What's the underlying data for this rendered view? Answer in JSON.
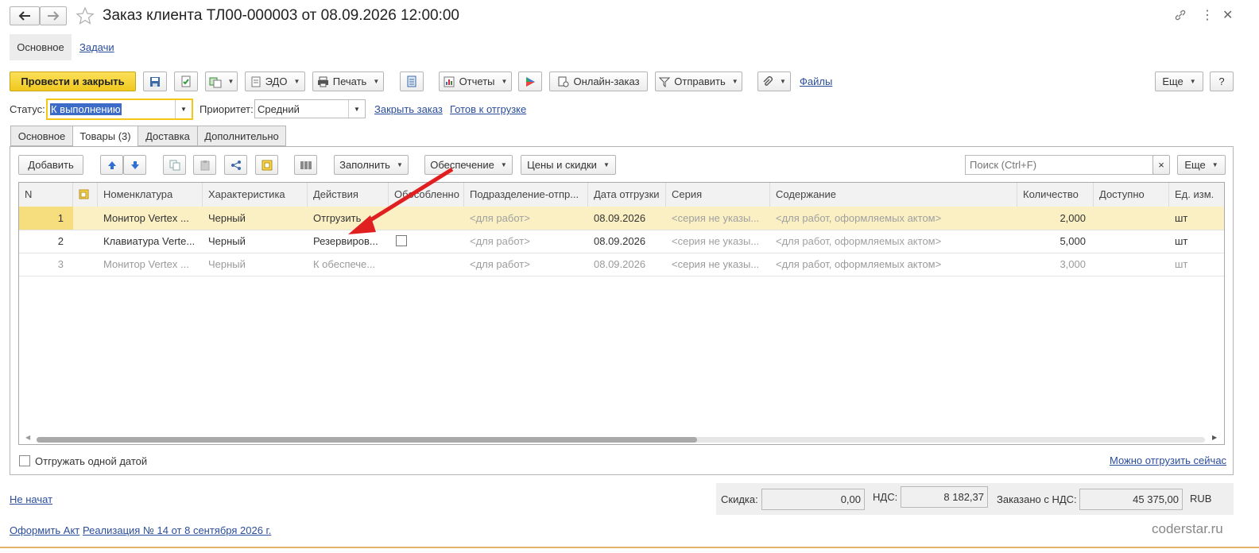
{
  "window": {
    "title": "Заказ клиента ТЛ00-000003 от 08.09.2026 12:00:00"
  },
  "nav": {
    "main": "Основное",
    "tasks": "Задачи"
  },
  "toolbar": {
    "post_close": "Провести и закрыть",
    "edo": "ЭДО",
    "print": "Печать",
    "reports": "Отчеты",
    "online_order": "Онлайн-заказ",
    "send": "Отправить",
    "files": "Файлы",
    "more": "Еще",
    "help": "?"
  },
  "status": {
    "label": "Статус:",
    "value": "К выполнению",
    "priority_label": "Приоритет:",
    "priority_value": "Средний",
    "close_order": "Закрыть заказ",
    "ready_ship": "Готов к отгрузке"
  },
  "tabs": [
    "Основное",
    "Товары (3)",
    "Доставка",
    "Дополнительно"
  ],
  "goods_toolbar": {
    "add": "Добавить",
    "fill": "Заполнить",
    "provision": "Обеспечение",
    "prices": "Цены и скидки",
    "search_placeholder": "Поиск (Ctrl+F)",
    "clear": "×",
    "more": "Еще"
  },
  "columns": [
    "N",
    "Номенклатура",
    "Характеристика",
    "Действия",
    "Обособленно",
    "Подразделение-отпр...",
    "Дата отгрузки",
    "Серия",
    "Содержание",
    "Количество",
    "Доступно",
    "Ед. изм."
  ],
  "rows": [
    {
      "n": "1",
      "item": "Монитор Vertex ...",
      "char": "Черный",
      "action": "Отгрузить",
      "division": "<для работ>",
      "date": "08.09.2026",
      "series": "<серия не указы...",
      "content": "<для работ, оформляемых актом>",
      "qty": "2,000",
      "avail": "",
      "unit": "шт"
    },
    {
      "n": "2",
      "item": "Клавиатура Verte...",
      "char": "Черный",
      "action": "Резервиров...",
      "division": "<для работ>",
      "date": "08.09.2026",
      "series": "<серия не указы...",
      "content": "<для работ, оформляемых актом>",
      "qty": "5,000",
      "avail": "",
      "unit": "шт"
    },
    {
      "n": "3",
      "item": "Монитор Vertex ...",
      "char": "Черный",
      "action": "К обеспече...",
      "division": "<для работ>",
      "date": "08.09.2026",
      "series": "<серия не указы...",
      "content": "<для работ, оформляемых актом>",
      "qty": "3,000",
      "avail": "",
      "unit": "шт"
    }
  ],
  "bottom": {
    "ship_one_date": "Отгружать одной датой",
    "can_ship_now": "Можно отгрузить сейчас",
    "not_started": "Не начат",
    "discount_label": "Скидка:",
    "discount": "0,00",
    "vat_label": "НДС:",
    "vat": "8 182,37",
    "ordered_label": "Заказано с НДС:",
    "ordered": "45 375,00",
    "currency": "RUB",
    "make_act": "Оформить Акт",
    "realization": "Реализация № 14 от 8 сентября 2026 г.",
    "watermark": "coderstar.ru"
  },
  "colors": {
    "accent_yellow": "#f5d02e",
    "link": "#2a4d9b",
    "selected_row": "#fbf0c4",
    "annotation_arrow": "#e02020"
  }
}
